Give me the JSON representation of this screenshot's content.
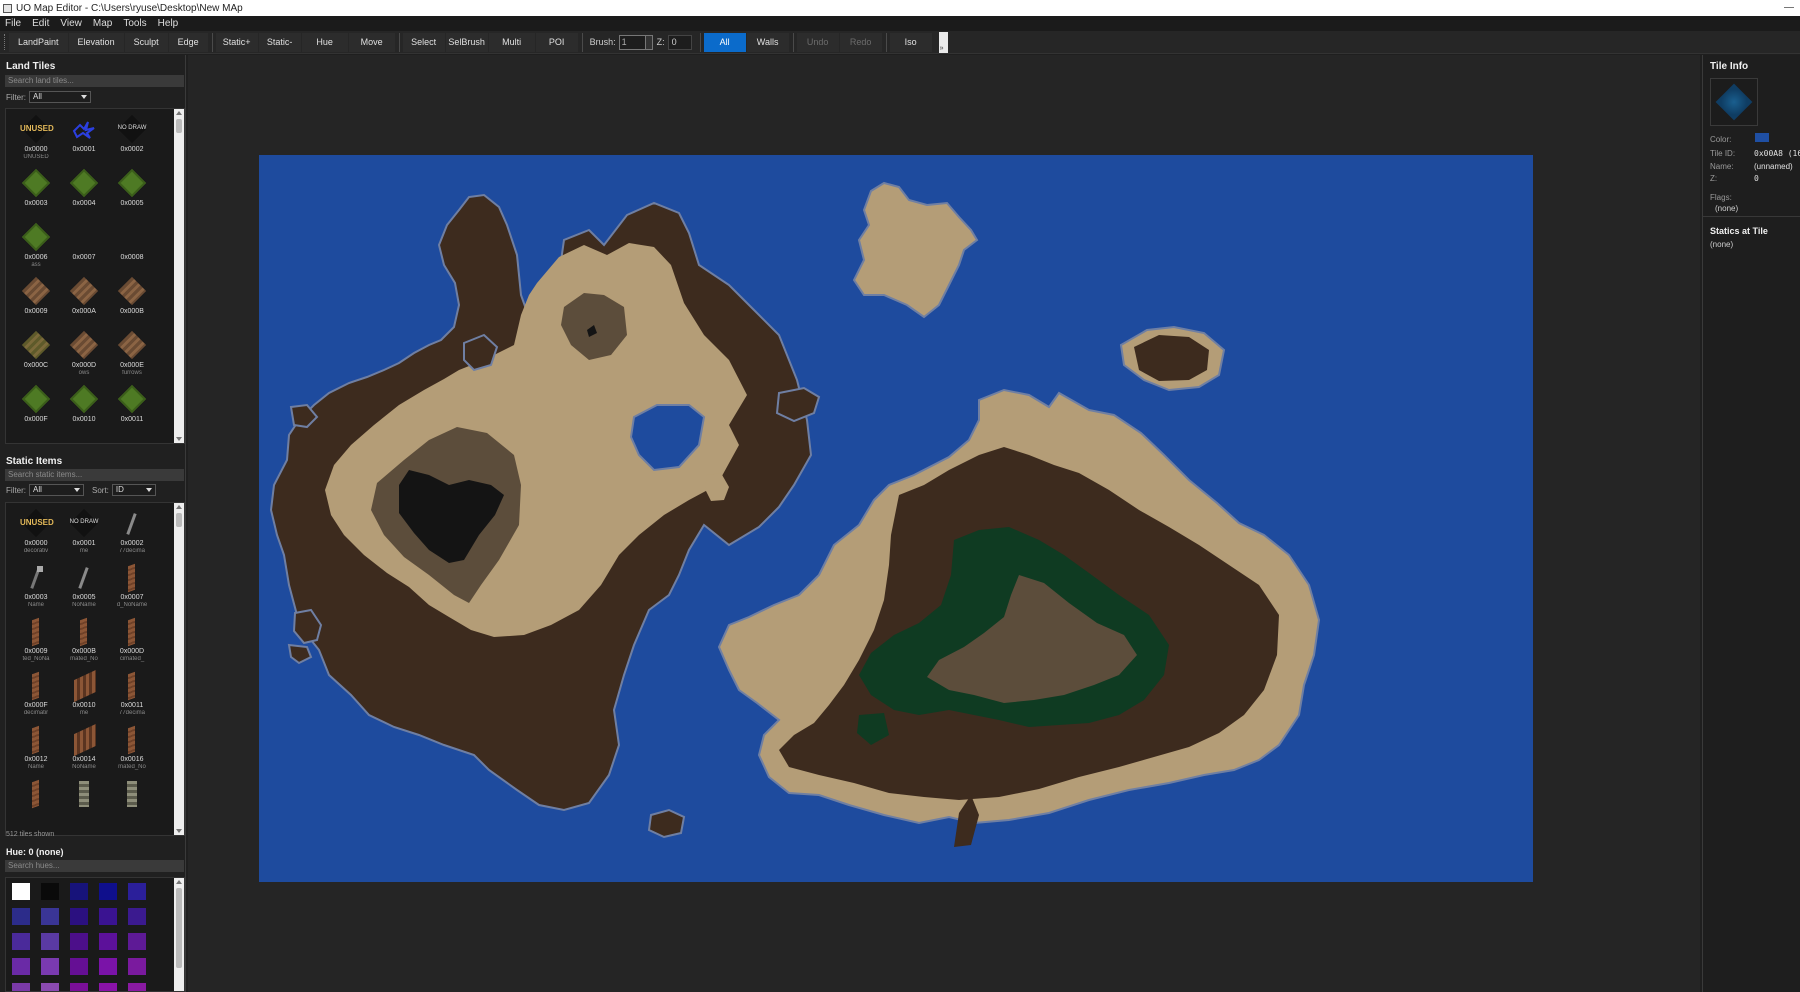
{
  "window": {
    "title": "UO Map Editor - C:\\Users\\ryuse\\Desktop\\New MAp"
  },
  "menu": [
    "File",
    "Edit",
    "View",
    "Map",
    "Tools",
    "Help"
  ],
  "toolbar": {
    "landpaint": "LandPaint",
    "elevation": "Elevation",
    "sculpt": "Sculpt",
    "edge": "Edge",
    "static_plus": "Static+",
    "static_minus": "Static-",
    "hue": "Hue",
    "move": "Move",
    "select": "Select",
    "selbrush": "SelBrush",
    "multi": "Multi",
    "poi": "POI",
    "brush_label": "Brush:",
    "brush_value": "1",
    "z_label": "Z:",
    "z_value": "0",
    "all": "All",
    "walls": "Walls",
    "undo": "Undo",
    "redo": "Redo",
    "iso": "Iso",
    "active_mode": "All"
  },
  "land_tiles": {
    "title": "Land Tiles",
    "search_placeholder": "Search land tiles...",
    "filter_label": "Filter:",
    "filter_value": "All",
    "tiles": [
      {
        "id": "0x0000",
        "name": "UNUSED",
        "icon": "unused-icon"
      },
      {
        "id": "0x0001",
        "name": "",
        "icon": "blue-lightning-icon"
      },
      {
        "id": "0x0002",
        "name": "",
        "icon": "no-draw-icon"
      },
      {
        "id": "0x0003",
        "name": "",
        "icon": "grass-tile-icon"
      },
      {
        "id": "0x0004",
        "name": "",
        "icon": "grass-tile-icon"
      },
      {
        "id": "0x0005",
        "name": "",
        "icon": "grass-tile-icon"
      },
      {
        "id": "0x0006",
        "name": "ass",
        "icon": "grass-tile-icon"
      },
      {
        "id": "0x0007",
        "name": "",
        "icon": "empty-tile-icon"
      },
      {
        "id": "0x0008",
        "name": "",
        "icon": "empty-tile-icon"
      },
      {
        "id": "0x0009",
        "name": "",
        "icon": "dirt-tile-icon"
      },
      {
        "id": "0x000A",
        "name": "",
        "icon": "dirt-tile-icon"
      },
      {
        "id": "0x000B",
        "name": "",
        "icon": "dirt-tile-icon"
      },
      {
        "id": "0x000C",
        "name": "",
        "icon": "dirt-grass-tile-icon"
      },
      {
        "id": "0x000D",
        "name": "ows",
        "icon": "dirt-tile-icon"
      },
      {
        "id": "0x000E",
        "name": "furrows",
        "icon": "dirt-tile-icon"
      },
      {
        "id": "0x000F",
        "name": "",
        "icon": "grass-tile-icon"
      },
      {
        "id": "0x0010",
        "name": "",
        "icon": "grass-tile-icon"
      },
      {
        "id": "0x0011",
        "name": "",
        "icon": "grass-tile-icon"
      }
    ]
  },
  "static_items": {
    "title": "Static Items",
    "search_placeholder": "Search static items...",
    "filter_label": "Filter:",
    "filter_value": "All",
    "sort_label": "Sort:",
    "sort_value": "ID",
    "items": [
      {
        "id": "0x0000",
        "name": "decorativ",
        "icon": "unused-icon"
      },
      {
        "id": "0x0001",
        "name": "me",
        "icon": "no-draw-icon"
      },
      {
        "id": "0x0002",
        "name": "77decima",
        "icon": "stick-icon"
      },
      {
        "id": "0x0003",
        "name": "Name",
        "icon": "axe-icon"
      },
      {
        "id": "0x0005",
        "name": "NoName",
        "icon": "stick-icon"
      },
      {
        "id": "0x0007",
        "name": "d_NoName",
        "icon": "plank-icon"
      },
      {
        "id": "0x0009",
        "name": "ted_NoNa",
        "icon": "plank-icon"
      },
      {
        "id": "0x000B",
        "name": "mated_No",
        "icon": "plank-icon"
      },
      {
        "id": "0x000D",
        "name": "cimated_",
        "icon": "plank-icon"
      },
      {
        "id": "0x000F",
        "name": "decimatir",
        "icon": "plank-icon"
      },
      {
        "id": "0x0010",
        "name": "me",
        "icon": "fence-icon"
      },
      {
        "id": "0x0011",
        "name": "77decima",
        "icon": "plank-icon"
      },
      {
        "id": "0x0012",
        "name": "Name",
        "icon": "plank-icon"
      },
      {
        "id": "0x0014",
        "name": "NoName",
        "icon": "fence-icon"
      },
      {
        "id": "0x0016",
        "name": "mated_No",
        "icon": "plank-icon"
      },
      {
        "id": "",
        "name": "",
        "icon": "plank-icon"
      },
      {
        "id": "",
        "name": "",
        "icon": "pillar-icon"
      },
      {
        "id": "",
        "name": "",
        "icon": "pillar-icon"
      }
    ],
    "count_text": "512 tiles shown"
  },
  "hues": {
    "title": "Hue: 0 (none)",
    "search_placeholder": "Search hues...",
    "swatches": [
      "#ffffff",
      "#0a0a0a",
      "#17137a",
      "#0f0f8c",
      "#2b1f9a",
      "#2c2c8a",
      "#3a3596",
      "#2b1080",
      "#3a1391",
      "#3b1a8f",
      "#4a2a9a",
      "#5a3aa3",
      "#4c0f8a",
      "#5c119a",
      "#5e1a96",
      "#6a2aa6",
      "#7a3ab0",
      "#650f94",
      "#7a13a8",
      "#7a1a9e",
      "#7a3aa8",
      "#8a4ab0",
      "#7a0f98",
      "#8a13a8",
      "#8a1aa2"
    ]
  },
  "tile_info": {
    "title": "Tile Info",
    "color_label": "Color:",
    "color_value": "#1f4fa3",
    "tile_id_label": "Tile ID:",
    "tile_id_value": "0x00A8 (16",
    "name_label": "Name:",
    "name_value": "(unnamed)",
    "z_label": "Z:",
    "z_value": "0",
    "flags_label": "Flags:",
    "flags_value": "(none)",
    "statics_title": "Statics at Tile",
    "statics_value": "(none)"
  },
  "map": {
    "water_color": "#1e4b9e",
    "dirt_color": "#3d2b1e",
    "sand_color": "#b49d77",
    "rock_color": "#5c4d3b",
    "dark_color": "#141414",
    "forest_color": "#0f3b22"
  }
}
